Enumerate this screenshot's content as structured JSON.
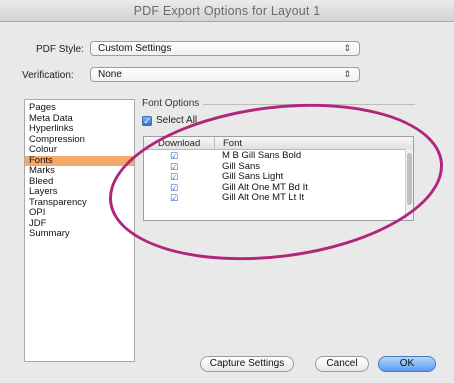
{
  "window": {
    "title": "PDF Export Options for Layout 1"
  },
  "pdf_style": {
    "label": "PDF Style:",
    "value": "Custom Settings"
  },
  "verification": {
    "label": "Verification:",
    "value": "None"
  },
  "sidebar": {
    "items": [
      {
        "label": "Pages",
        "selected": false
      },
      {
        "label": "Meta Data",
        "selected": false
      },
      {
        "label": "Hyperlinks",
        "selected": false
      },
      {
        "label": "Compression",
        "selected": false
      },
      {
        "label": "Colour",
        "selected": false
      },
      {
        "label": "Fonts",
        "selected": true
      },
      {
        "label": "Marks",
        "selected": false
      },
      {
        "label": "Bleed",
        "selected": false
      },
      {
        "label": "Layers",
        "selected": false
      },
      {
        "label": "Transparency",
        "selected": false
      },
      {
        "label": "OPI",
        "selected": false
      },
      {
        "label": "JDF",
        "selected": false
      },
      {
        "label": "Summary",
        "selected": false
      }
    ]
  },
  "font_options": {
    "group_label": "Font Options",
    "select_all_label": "Select All",
    "select_all_checked": true,
    "columns": [
      "Download",
      "Font"
    ],
    "rows": [
      {
        "font": "M B Gill Sans Bold",
        "download": true
      },
      {
        "font": "Gill Sans",
        "download": true
      },
      {
        "font": "Gill Sans Light",
        "download": true
      },
      {
        "font": "Gill Alt One MT Bd It",
        "download": true
      },
      {
        "font": "Gill Alt One MT Lt It",
        "download": true
      }
    ]
  },
  "buttons": {
    "capture": "Capture Settings",
    "cancel": "Cancel",
    "ok": "OK"
  },
  "colors": {
    "selection": "#f3a96b",
    "annotation": "#b0267c",
    "accent": "#5b9cf1"
  }
}
